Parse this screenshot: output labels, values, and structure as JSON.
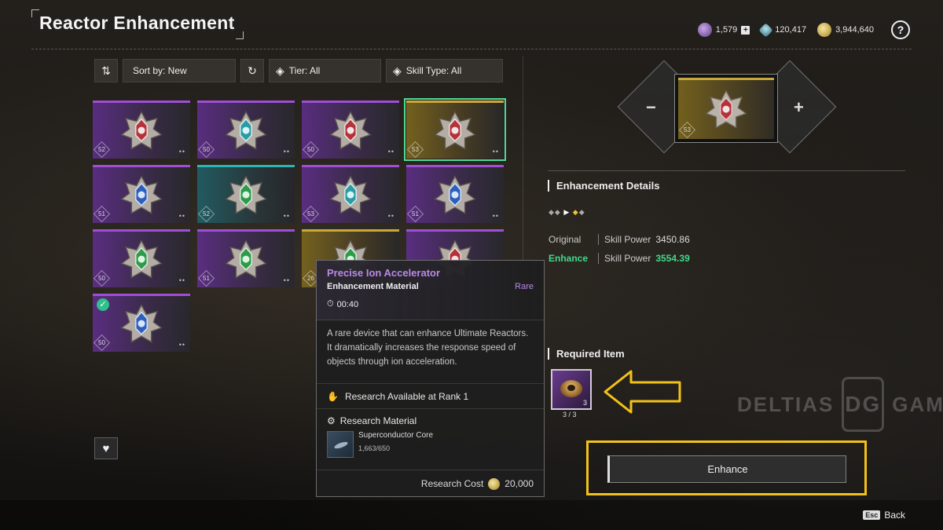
{
  "header": {
    "title": "Reactor Enhancement",
    "currencies": [
      {
        "icon": "purple-crystal-icon",
        "value": "1,579",
        "has_add": true
      },
      {
        "icon": "teal-gem-icon",
        "value": "120,417",
        "has_add": false
      },
      {
        "icon": "gold-coin-icon",
        "value": "3,944,640",
        "has_add": false
      }
    ],
    "help_label": "?"
  },
  "toolbar": {
    "sort_label": "Sort by: New",
    "tier_label": "Tier: All",
    "skill_type_label": "Skill Type: All"
  },
  "reactors": [
    {
      "level": "52",
      "tier": "purple",
      "core": "red",
      "selected": false,
      "equipped": false
    },
    {
      "level": "50",
      "tier": "purple",
      "core": "teal",
      "selected": false,
      "equipped": false
    },
    {
      "level": "50",
      "tier": "purple",
      "core": "red",
      "selected": false,
      "equipped": false
    },
    {
      "level": "53",
      "tier": "gold",
      "core": "red",
      "selected": true,
      "equipped": false
    },
    {
      "level": "51",
      "tier": "purple",
      "core": "blue",
      "selected": false,
      "equipped": false
    },
    {
      "level": "52",
      "tier": "teal",
      "core": "green",
      "selected": false,
      "equipped": false
    },
    {
      "level": "53",
      "tier": "purple",
      "core": "teal",
      "selected": false,
      "equipped": false
    },
    {
      "level": "51",
      "tier": "purple",
      "core": "blue",
      "selected": false,
      "equipped": false
    },
    {
      "level": "50",
      "tier": "purple",
      "core": "green",
      "selected": false,
      "equipped": false
    },
    {
      "level": "51",
      "tier": "purple",
      "core": "green",
      "selected": false,
      "equipped": false
    },
    {
      "level": "26",
      "tier": "gold",
      "core": "green",
      "selected": false,
      "equipped": false
    },
    {
      "level": "",
      "tier": "purple",
      "core": "red",
      "selected": false,
      "equipped": false
    },
    {
      "level": "50",
      "tier": "purple",
      "core": "blue",
      "selected": false,
      "equipped": true
    }
  ],
  "tooltip": {
    "name": "Precise Ion Accelerator",
    "type": "Enhancement Material",
    "rarity": "Rare",
    "timer": "00:40",
    "description": "A rare device that can enhance Ultimate Reactors. It dramatically increases the response speed of objects through ion acceleration.",
    "rank_text": "Research Available at Rank 1",
    "research_title": "Research Material",
    "material_name": "Superconductor Core",
    "material_count": "1,663/650",
    "cost_label": "Research Cost",
    "cost_value": "20,000"
  },
  "preview": {
    "level": "53",
    "minus": "−",
    "plus": "+"
  },
  "details": {
    "title": "Enhancement Details",
    "original_label": "Original",
    "original_stat": "Skill Power",
    "original_value": "3450.86",
    "enhance_label": "Enhance",
    "enhance_stat": "Skill Power",
    "enhance_value": "3554.39"
  },
  "required": {
    "title": "Required Item",
    "item_qty": "3",
    "count": "3 / 3"
  },
  "enhance_button": "Enhance",
  "watermark": {
    "left": "DELTIAS",
    "logo": "DG",
    "right": "GAMING"
  },
  "footer": {
    "esc_key": "Esc",
    "back_label": "Back"
  },
  "colors": {
    "accent_green": "#41d98a",
    "highlight_yellow": "#f2c21a",
    "rare_purple": "#b88ae6"
  }
}
